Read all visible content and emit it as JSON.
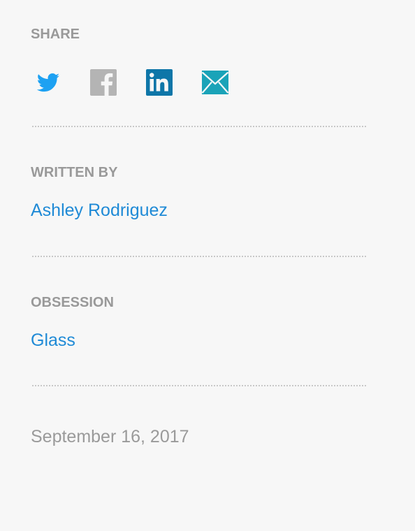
{
  "share": {
    "label": "SHARE",
    "icons": [
      {
        "name": "twitter-icon",
        "color": "#1da1f2"
      },
      {
        "name": "facebook-icon",
        "color": "#b4b4b4"
      },
      {
        "name": "linkedin-icon",
        "color": "#0e76a8"
      },
      {
        "name": "email-icon",
        "color": "#1aa3b8"
      }
    ]
  },
  "written_by": {
    "label": "WRITTEN BY",
    "author": "Ashley Rodriguez"
  },
  "obsession": {
    "label": "OBSESSION",
    "topic": "Glass"
  },
  "date": "September 16, 2017",
  "colors": {
    "background": "#f7f7f7",
    "label_gray": "#999999",
    "link_blue": "#1f8ad6",
    "divider": "#c8c8c8"
  }
}
